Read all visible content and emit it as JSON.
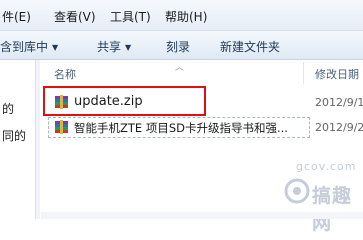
{
  "menu": {
    "edit": "件(E)",
    "view": "查看(V)",
    "tools": "工具(T)",
    "help": "帮助(H)"
  },
  "commands": {
    "library": "含到库中",
    "share": "共享",
    "burn": "刻录",
    "new_folder": "新建文件夹"
  },
  "nav": {
    "text1": "的",
    "text2": "同的"
  },
  "columns": {
    "name": "名称",
    "modified": "修改日期"
  },
  "files": [
    {
      "name": "update.zip",
      "date": "2012/9/1",
      "icon": "winrar-archive-icon"
    },
    {
      "name": "智能手机ZTE 项目SD卡升级指导书和强...",
      "date": "2012/9/2",
      "icon": "winrar-archive-icon"
    }
  ],
  "watermark": {
    "url": "gcov.com",
    "text": "搞趣网"
  }
}
